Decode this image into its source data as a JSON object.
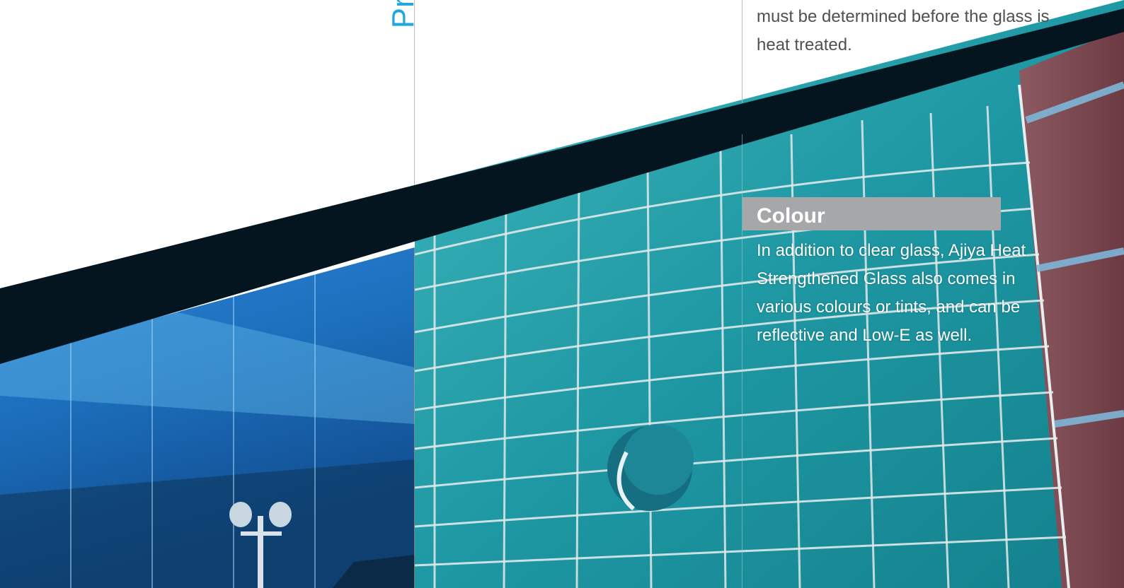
{
  "brochure": {
    "vertical_title_fragment": "Pro",
    "intro_text": "must be determined before the glass is heat treated.",
    "colour_section": {
      "heading": "Colour",
      "body": "In addition to clear glass, Ajiya Heat Strengthened Glass also comes in various colours or tints, and can be reflective and Low-E as well."
    }
  },
  "colors": {
    "accent_blue": "#1ea8e0",
    "dark_band": "#04151f",
    "heading_bar": "#a6a7a9",
    "body_grey": "#505050"
  }
}
